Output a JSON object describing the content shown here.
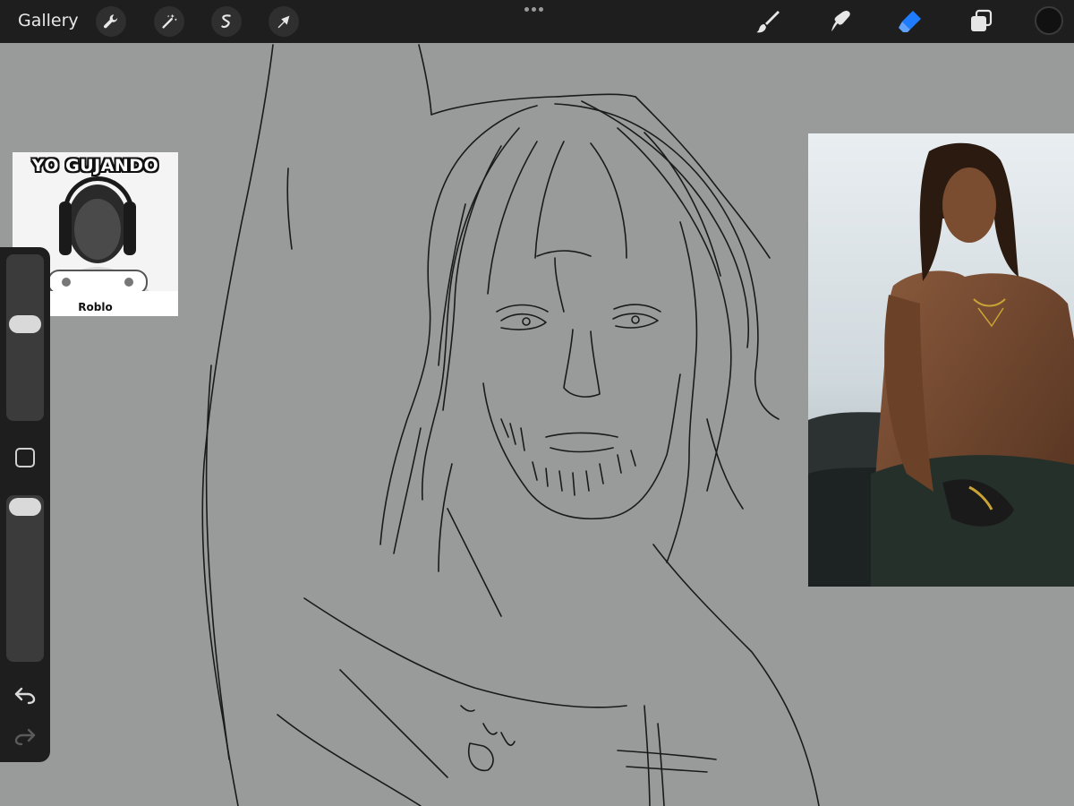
{
  "topbar": {
    "gallery_label": "Gallery",
    "left_tools": [
      {
        "name": "wrench-icon",
        "label": "Actions"
      },
      {
        "name": "magic-wand-icon",
        "label": "Adjustments"
      },
      {
        "name": "selection-icon",
        "label": "Selection"
      },
      {
        "name": "arrow-icon",
        "label": "Transform"
      }
    ],
    "right_tools": [
      {
        "name": "brush-icon",
        "label": "Brush"
      },
      {
        "name": "smudge-icon",
        "label": "Smudge"
      },
      {
        "name": "eraser-icon",
        "label": "Eraser",
        "active": true
      },
      {
        "name": "layers-icon",
        "label": "Layers"
      }
    ],
    "active_color": "#111111",
    "accent": "#1f7bff"
  },
  "canvas": {
    "background": "#999b9b",
    "meme_reference": {
      "title": "YO GUJANDO",
      "caption": "Roblo"
    }
  },
  "sidebar": {
    "brush_size_level": 0.42,
    "opacity_level": 0.05,
    "undo_icon": "undo-icon",
    "redo_icon": "redo-icon"
  }
}
